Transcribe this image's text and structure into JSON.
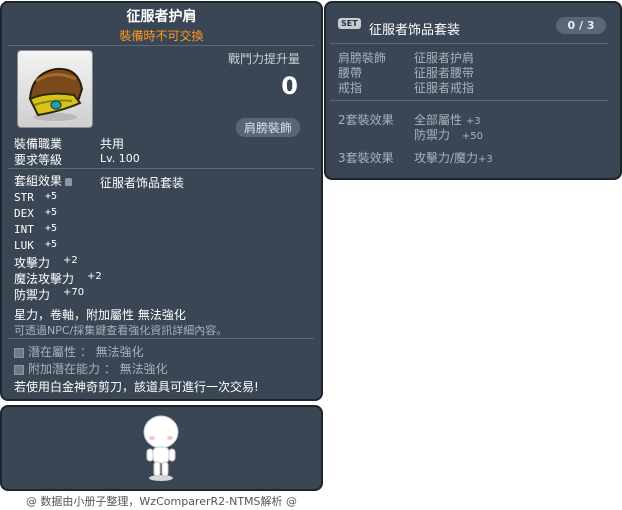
{
  "item_id": "01152080",
  "item": {
    "name": "征服者护肩",
    "untradeable": "裝備時不可交換",
    "power_label": "戰鬥力提升量",
    "power_value": "0",
    "slot_badge": "肩膀裝飾",
    "job_label": "裝備職業",
    "job_value": "共用",
    "level_label": "要求等級",
    "level_value": "Lv. 100",
    "set_label": "套組效果",
    "set_value": "征服者饰品套装",
    "stats": [
      {
        "name": "STR",
        "value": "+5"
      },
      {
        "name": "DEX",
        "value": "+5"
      },
      {
        "name": "INT",
        "value": "+5"
      },
      {
        "name": "LUK",
        "value": "+5"
      },
      {
        "name": "攻擊力",
        "value": "+2"
      },
      {
        "name": "魔法攻擊力",
        "value": "+2"
      },
      {
        "name": "防禦力",
        "value": "+70"
      }
    ],
    "enhance_line": "星力，卷軸，附加屬性 無法強化",
    "enhance_hint": "可透過NPC/採集鍵查看強化資訊詳細內容。",
    "potential": "潛在屬性 ： 無法強化",
    "additional_potential": "附加潛在能力 ： 無法強化",
    "trade_note": "若使用白金神奇剪刀，該道具可進行一次交易!"
  },
  "set": {
    "badge": "SET",
    "name": "征服者饰品套装",
    "count": "0 / 3",
    "members": [
      {
        "slot": "肩膀裝飾",
        "item": "征服者护肩"
      },
      {
        "slot": "腰帶",
        "item": "征服者腰带"
      },
      {
        "slot": "戒指",
        "item": "征服者戒指"
      }
    ],
    "effects": [
      {
        "label": "2套裝效果",
        "lines": [
          {
            "name": "全部屬性",
            "value": "+3"
          },
          {
            "name": "防禦力",
            "value": "+50"
          }
        ]
      },
      {
        "label": "3套裝效果",
        "lines": [
          {
            "name": "攻擊力/魔力",
            "value": "+3"
          }
        ]
      }
    ]
  },
  "footer": "@ 数据由小册子整理，WzComparerR2-NTMS解析 @",
  "icon": "shoulder-armor-icon"
}
